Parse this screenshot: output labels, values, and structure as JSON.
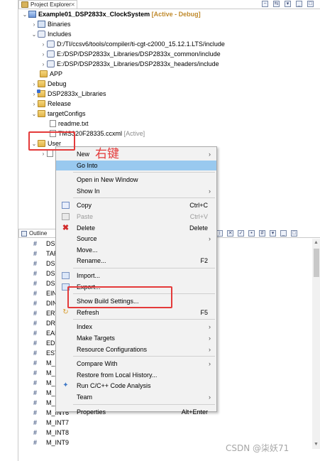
{
  "project_explorer": {
    "tab_title": "Project Explorer",
    "close": "⨯",
    "tree": [
      {
        "label": "Example01_DSP2833x_ClockSystem",
        "suffix": "[Active - Debug]",
        "icon": "project-icon",
        "expanded": true
      },
      {
        "label": "Binaries",
        "icon": "binaries-icon"
      },
      {
        "label": "Includes",
        "icon": "includes-icon",
        "expanded": true
      },
      {
        "label": "D:/TI/ccsv6/tools/compiler/ti-cgt-c2000_15.12.1.LTS/include",
        "icon": "include-path-icon"
      },
      {
        "label": "E:/DSP/DSP2833x_Libraries/DSP2833x_common/include",
        "icon": "include-path-icon"
      },
      {
        "label": "E:/DSP/DSP2833x_Libraries/DSP2833x_headers/include",
        "icon": "include-path-icon"
      },
      {
        "label": "APP",
        "icon": "folder-icon"
      },
      {
        "label": "Debug",
        "icon": "folder-icon"
      },
      {
        "label": "DSP2833x_Libraries",
        "icon": "linked-folder-icon"
      },
      {
        "label": "Release",
        "icon": "folder-icon"
      },
      {
        "label": "targetConfigs",
        "icon": "folder-icon",
        "expanded": true
      },
      {
        "label": "readme.txt",
        "icon": "text-file-icon"
      },
      {
        "label": "TMS320F28335.ccxml",
        "suffix": "[Active]",
        "icon": "ccxml-file-icon"
      },
      {
        "label": "User",
        "icon": "folder-icon",
        "expanded": true
      }
    ]
  },
  "outline": {
    "tab_title": "Outline",
    "items": [
      "DSP",
      "TAR",
      "DSP",
      "DSP",
      "DSP",
      "EINT",
      "DINT",
      "ERTI",
      "DRT",
      "EALL",
      "EDIS",
      "ESTO",
      "M_II",
      "M_II",
      "M_II",
      "M_II",
      "M_II",
      "M_INT6",
      "M_INT7",
      "M_INT8",
      "M_INT9"
    ]
  },
  "context_menu": {
    "items": [
      {
        "label": "New",
        "submenu": true
      },
      {
        "label": "Go Into",
        "highlighted": true
      },
      {
        "sep": true
      },
      {
        "label": "Open in New Window"
      },
      {
        "label": "Show In",
        "submenu": true
      },
      {
        "sep": true
      },
      {
        "label": "Copy",
        "shortcut": "Ctrl+C",
        "icon": "copy-icon"
      },
      {
        "label": "Paste",
        "shortcut": "Ctrl+V",
        "icon": "paste-icon",
        "disabled": true
      },
      {
        "label": "Delete",
        "shortcut": "Delete",
        "icon": "delete-icon"
      },
      {
        "label": "Source",
        "submenu": true
      },
      {
        "label": "Move..."
      },
      {
        "label": "Rename...",
        "shortcut": "F2"
      },
      {
        "sep": true
      },
      {
        "label": "Import...",
        "icon": "import-icon"
      },
      {
        "label": "Export...",
        "icon": "export-icon"
      },
      {
        "sep": true
      },
      {
        "label": "Show Build Settings..."
      },
      {
        "label": "Refresh",
        "shortcut": "F5",
        "icon": "refresh-icon"
      },
      {
        "sep": true
      },
      {
        "label": "Index",
        "submenu": true
      },
      {
        "label": "Make Targets",
        "submenu": true
      },
      {
        "label": "Resource Configurations",
        "submenu": true
      },
      {
        "sep": true
      },
      {
        "label": "Compare With",
        "submenu": true
      },
      {
        "label": "Restore from Local History..."
      },
      {
        "label": "Run C/C++ Code Analysis",
        "icon": "run-analysis-icon"
      },
      {
        "label": "Team",
        "submenu": true
      },
      {
        "sep": true
      },
      {
        "label": "Properties",
        "shortcut": "Alt+Enter"
      }
    ]
  },
  "annotations": {
    "right_click_label": "右键",
    "watermark": "CSDN @柒妖71"
  },
  "colors": {
    "highlight": "#99c9ef",
    "annotation_red": "#e43a3a"
  }
}
